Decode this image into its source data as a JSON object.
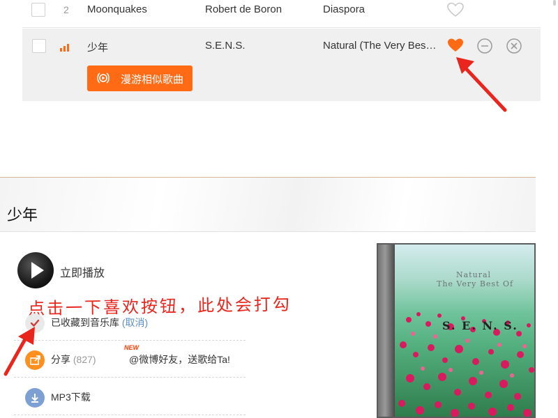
{
  "playlist": {
    "rows": [
      {
        "index": "2",
        "title": "Moonquakes",
        "artist": "Robert de Boron",
        "album": "Diaspora",
        "liked": false
      },
      {
        "index": "",
        "title": "少年",
        "artist": "S.E.N.S.",
        "album": "Natural (The Very Bes…",
        "liked": true
      }
    ],
    "roam_button_label": "漫游相似歌曲"
  },
  "song": {
    "title": "少年",
    "play_label": "立即播放",
    "annotation": "点击一下喜欢按钮，此处会打勾",
    "collected_label": "已收藏到音乐库",
    "cancel_label": "(取消)",
    "share_label": "分享",
    "share_count": "(827)",
    "new_badge": "NEW",
    "share_sub": "@微博好友，送歌给Ta!",
    "mp3_label": "MP3下载"
  },
  "album": {
    "line1": "Natural",
    "line2": "The Very Best Of",
    "artist": "S. E. N. S."
  },
  "colors": {
    "accent": "#ff6a14",
    "arrow": "#e8261e",
    "link": "#5b8fc9"
  }
}
